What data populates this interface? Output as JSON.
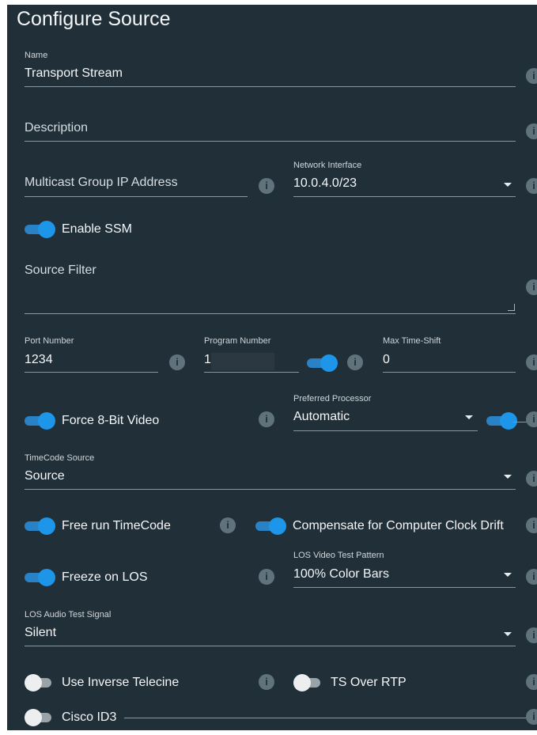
{
  "title": "Configure Source",
  "name": {
    "label": "Name",
    "value": "Transport Stream"
  },
  "description": {
    "placeholder": "Description"
  },
  "multicast": {
    "placeholder": "Multicast Group IP Address"
  },
  "network_interface": {
    "label": "Network Interface",
    "value": "10.0.4.0/23"
  },
  "enable_ssm": {
    "label": "Enable SSM",
    "on": true
  },
  "source_filter": {
    "placeholder": "Source Filter"
  },
  "port_number": {
    "label": "Port Number",
    "value": "1234"
  },
  "program_number": {
    "label": "Program Number",
    "value": "1",
    "toggle_on": true
  },
  "max_time_shift": {
    "label": "Max Time-Shift",
    "value": "0"
  },
  "force_8bit": {
    "label": "Force 8-Bit Video",
    "on": true
  },
  "preferred_processor": {
    "label": "Preferred Processor",
    "value": "Automatic",
    "toggle_on": true
  },
  "timecode_source": {
    "label": "TimeCode Source",
    "value": "Source"
  },
  "free_run": {
    "label": "Free run TimeCode",
    "on": true
  },
  "compensate": {
    "label": "Compensate for Computer Clock Drift",
    "on": true
  },
  "freeze_los": {
    "label": "Freeze on LOS",
    "on": true
  },
  "los_video": {
    "label": "LOS Video Test Pattern",
    "value": "100% Color Bars"
  },
  "los_audio": {
    "label": "LOS Audio Test Signal",
    "value": "Silent"
  },
  "inverse_telecine": {
    "label": "Use Inverse Telecine",
    "on": false
  },
  "ts_over_rtp": {
    "label": "TS Over RTP",
    "on": false
  },
  "cisco_id3": {
    "label": "Cisco ID3",
    "on": false
  },
  "info_glyph": "i",
  "colors": {
    "panel": "#213038",
    "accent": "#1d95e8",
    "highlight_line": "#e0813c"
  }
}
